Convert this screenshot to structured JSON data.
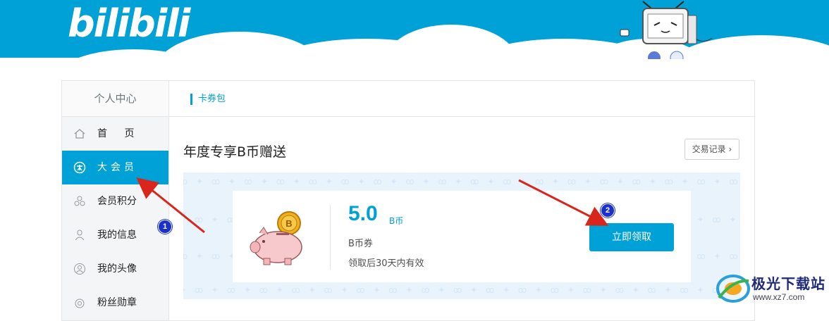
{
  "header": {
    "logo_text": "bilibili",
    "brand_color": "#00a1d6"
  },
  "sidebar": {
    "title": "个人中心",
    "items": [
      {
        "label": "首  页",
        "icon": "home-icon",
        "active": false
      },
      {
        "label": "大会员",
        "icon": "vip-icon",
        "active": true
      },
      {
        "label": "会员积分",
        "icon": "points-icon",
        "active": false
      },
      {
        "label": "我的信息",
        "icon": "user-icon",
        "active": false
      },
      {
        "label": "我的头像",
        "icon": "avatar-icon",
        "active": false
      },
      {
        "label": "粉丝勋章",
        "icon": "medal-icon",
        "active": false
      }
    ]
  },
  "main": {
    "tab": "卡券包",
    "section_title": "年度专享B币赠送",
    "record_button": "交易记录"
  },
  "coupon": {
    "amount": "5.0",
    "unit": "B币",
    "name": "B币券",
    "validity": "领取后30天内有效",
    "claim_button": "立即领取"
  },
  "annotations": {
    "badge_1": "1",
    "badge_2": "2"
  },
  "watermark": {
    "text": "极光下载站",
    "url": "www.xz7.com"
  }
}
